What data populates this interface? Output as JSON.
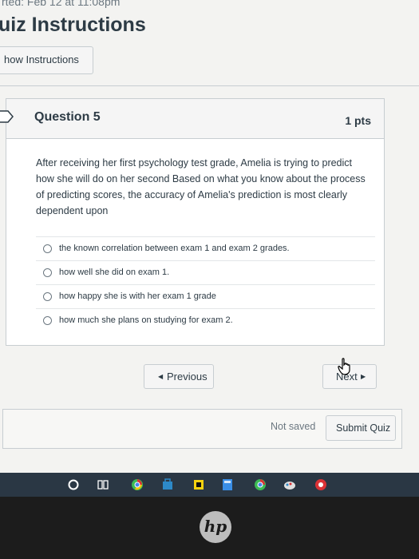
{
  "header": {
    "started": "rted: Feb 12 at 11:08pm",
    "title": "uiz Instructions",
    "show_instructions": "how Instructions"
  },
  "question": {
    "name": "Question 5",
    "points": "1 pts",
    "text": "After receiving her first psychology test grade, Amelia is trying to predict how she will do on her second Based on what you know about the process of predicting scores, the accuracy of Amelia's prediction is most clearly dependent upon",
    "answers": [
      "the known correlation between exam 1 and exam 2 grades.",
      "how well she did on exam 1.",
      "how happy she is with her exam 1 grade",
      "how much she plans on studying for exam 2."
    ]
  },
  "navigation": {
    "previous": "Previous",
    "next": "Next"
  },
  "footer": {
    "status": "Not saved",
    "submit": "Submit Quiz"
  },
  "taskbar": {
    "icons": [
      "cortana-icon",
      "task-view-icon",
      "chrome-icon",
      "store-icon",
      "sticky-notes-icon",
      "calculator-icon",
      "chrome-profile-icon",
      "paint-icon",
      "chrome-alt-icon"
    ]
  },
  "device": {
    "logo": "hp"
  },
  "colors": {
    "text": "#2d3b45",
    "border": "#c7cdd1",
    "taskbar": "#2a3744"
  }
}
